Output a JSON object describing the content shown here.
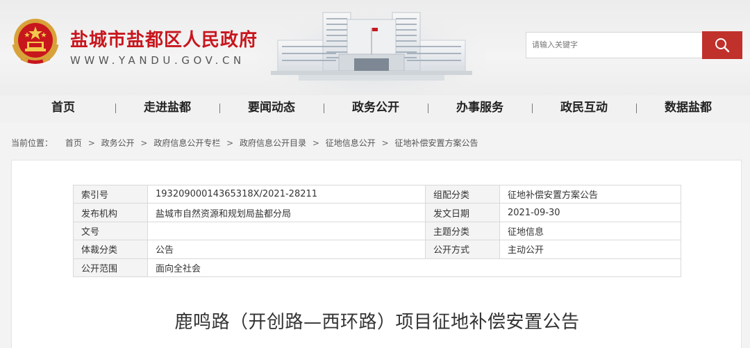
{
  "header": {
    "site_title": "盐城市盐都区人民政府",
    "site_url": "WWW.YANDU.GOV.CN",
    "search_placeholder": "请输入关键字",
    "brand_color": "#c8161d"
  },
  "nav": {
    "items": [
      "首页",
      "走进盐都",
      "要闻动态",
      "政务公开",
      "办事服务",
      "政民互动",
      "数据盐都"
    ]
  },
  "breadcrumb": {
    "prefix": "当前位置：",
    "items": [
      "首页",
      "政务公开",
      "政府信息公开专栏",
      "政府信息公开目录",
      "征地信息公开",
      "征地补偿安置方案公告"
    ],
    "separator": ">"
  },
  "meta": {
    "rows": [
      {
        "k1": "索引号",
        "v1": "19320900014365318X/2021-28211",
        "k2": "组配分类",
        "v2": "征地补偿安置方案公告"
      },
      {
        "k1": "发布机构",
        "v1": "盐城市自然资源和规划局盐都分局",
        "k2": "发文日期",
        "v2": "2021-09-30"
      },
      {
        "k1": "文号",
        "v1": "",
        "k2": "主题分类",
        "v2": "征地信息"
      },
      {
        "k1": "体裁分类",
        "v1": "公告",
        "k2": "公开方式",
        "v2": "主动公开"
      },
      {
        "k1": "公开范围",
        "v1": "面向全社会"
      }
    ]
  },
  "article": {
    "title": "鹿鸣路（开创路—西环路）项目征地补偿安置公告"
  }
}
